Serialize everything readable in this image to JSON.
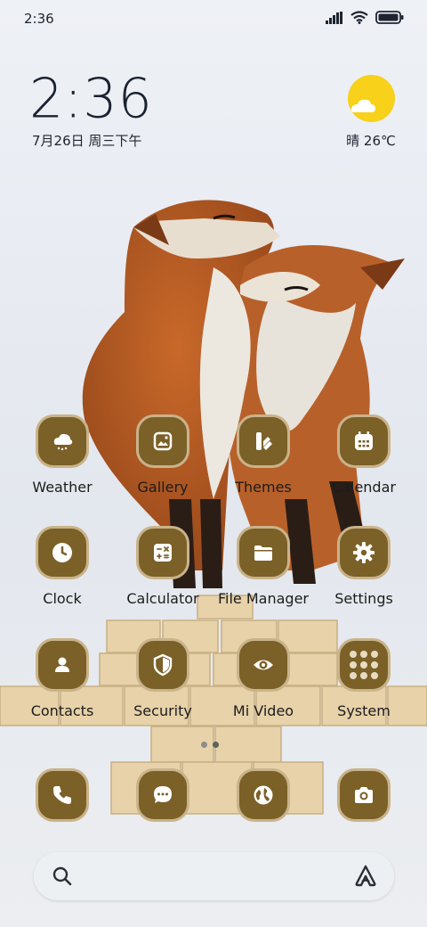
{
  "status_bar": {
    "time": "2:36"
  },
  "clock_widget": {
    "time": "2:36",
    "date": "7月26日 周三下午"
  },
  "weather_widget": {
    "condition": "晴",
    "temperature": "26℃",
    "icon": "sun-cloud-icon"
  },
  "apps": [
    {
      "label": "Weather",
      "icon": "weather-cloud-icon"
    },
    {
      "label": "Gallery",
      "icon": "gallery-icon"
    },
    {
      "label": "Themes",
      "icon": "themes-icon"
    },
    {
      "label": "Calendar",
      "icon": "calendar-icon"
    },
    {
      "label": "Clock",
      "icon": "clock-icon"
    },
    {
      "label": "Calculator",
      "icon": "calculator-icon"
    },
    {
      "label": "File Manager",
      "icon": "folder-icon"
    },
    {
      "label": "Settings",
      "icon": "gear-icon"
    },
    {
      "label": "Contacts",
      "icon": "contacts-icon"
    },
    {
      "label": "Security",
      "icon": "shield-icon"
    },
    {
      "label": "Mi Video",
      "icon": "eye-icon"
    },
    {
      "label": "System",
      "icon": "folder-grid-icon"
    }
  ],
  "dock": [
    {
      "icon": "phone-icon"
    },
    {
      "icon": "messages-icon"
    },
    {
      "icon": "browser-globe-icon"
    },
    {
      "icon": "camera-icon"
    }
  ],
  "page_indicator": {
    "current": 2,
    "total": 2
  },
  "search": {
    "placeholder": ""
  },
  "colors": {
    "tile": "#7b6027",
    "tile_border": "#c9b38a",
    "sun": "#f7d11a"
  }
}
